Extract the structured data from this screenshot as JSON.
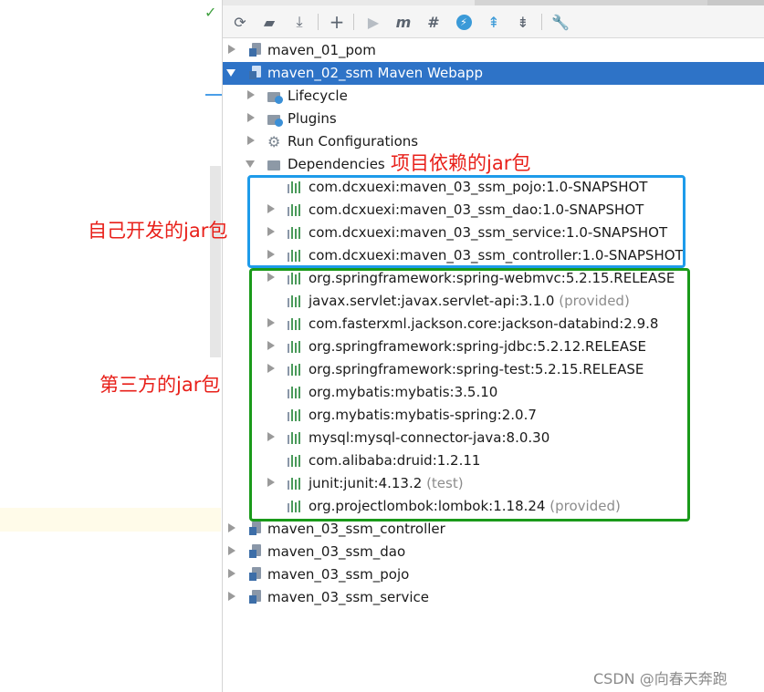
{
  "toolbar": {
    "icons": [
      "reimport-icon",
      "generate-sources-icon",
      "download-icon",
      "add-icon",
      "run-icon",
      "execute-goal-icon",
      "toggle-offline-icon",
      "skip-tests-icon",
      "show-dependencies-icon",
      "collapse-all-icon",
      "settings-icon"
    ]
  },
  "tree": {
    "modules_top": [
      {
        "label": "maven_01_pom",
        "expanded": false
      },
      {
        "label": "maven_02_ssm Maven Webapp",
        "expanded": true,
        "selected": true
      }
    ],
    "children": [
      {
        "label": "Lifecycle",
        "icon": "folder-gear-icon"
      },
      {
        "label": "Plugins",
        "icon": "folder-gear-icon"
      },
      {
        "label": "Run Configurations",
        "icon": "gear-icon"
      },
      {
        "label": "Dependencies",
        "icon": "dependencies-icon",
        "expanded": true
      }
    ],
    "dependencies": [
      {
        "label": "com.dcxuexi:maven_03_ssm_pojo:1.0-SNAPSHOT",
        "scope": "",
        "expandable": false
      },
      {
        "label": "com.dcxuexi:maven_03_ssm_dao:1.0-SNAPSHOT",
        "scope": "",
        "expandable": true
      },
      {
        "label": "com.dcxuexi:maven_03_ssm_service:1.0-SNAPSHOT",
        "scope": "",
        "expandable": true
      },
      {
        "label": "com.dcxuexi:maven_03_ssm_controller:1.0-SNAPSHOT",
        "scope": "",
        "expandable": true
      },
      {
        "label": "org.springframework:spring-webmvc:5.2.15.RELEASE",
        "scope": "",
        "expandable": true
      },
      {
        "label": "javax.servlet:javax.servlet-api:3.1.0",
        "scope": "(provided)",
        "expandable": false
      },
      {
        "label": "com.fasterxml.jackson.core:jackson-databind:2.9.8",
        "scope": "",
        "expandable": true
      },
      {
        "label": "org.springframework:spring-jdbc:5.2.12.RELEASE",
        "scope": "",
        "expandable": true
      },
      {
        "label": "org.springframework:spring-test:5.2.15.RELEASE",
        "scope": "",
        "expandable": true
      },
      {
        "label": "org.mybatis:mybatis:3.5.10",
        "scope": "",
        "expandable": false
      },
      {
        "label": "org.mybatis:mybatis-spring:2.0.7",
        "scope": "",
        "expandable": false
      },
      {
        "label": "mysql:mysql-connector-java:8.0.30",
        "scope": "",
        "expandable": true
      },
      {
        "label": "com.alibaba:druid:1.2.11",
        "scope": "",
        "expandable": false
      },
      {
        "label": "junit:junit:4.13.2",
        "scope": "(test)",
        "expandable": true
      },
      {
        "label": "org.projectlombok:lombok:1.18.24",
        "scope": "(provided)",
        "expandable": false
      }
    ],
    "modules_bottom": [
      {
        "label": "maven_03_ssm_controller"
      },
      {
        "label": "maven_03_ssm_dao"
      },
      {
        "label": "maven_03_ssm_pojo"
      },
      {
        "label": "maven_03_ssm_service"
      }
    ]
  },
  "annotations": {
    "project_deps": "项目依赖的jar包",
    "self_developed": "自己开发的jar包",
    "third_party": "第三方的jar包"
  },
  "colors": {
    "selection": "#2e73c7",
    "blue_box": "#1e9bea",
    "green_box": "#1a9a1a",
    "annotation_text": "#e8201a"
  },
  "watermark": "CSDN @向春天奔跑"
}
